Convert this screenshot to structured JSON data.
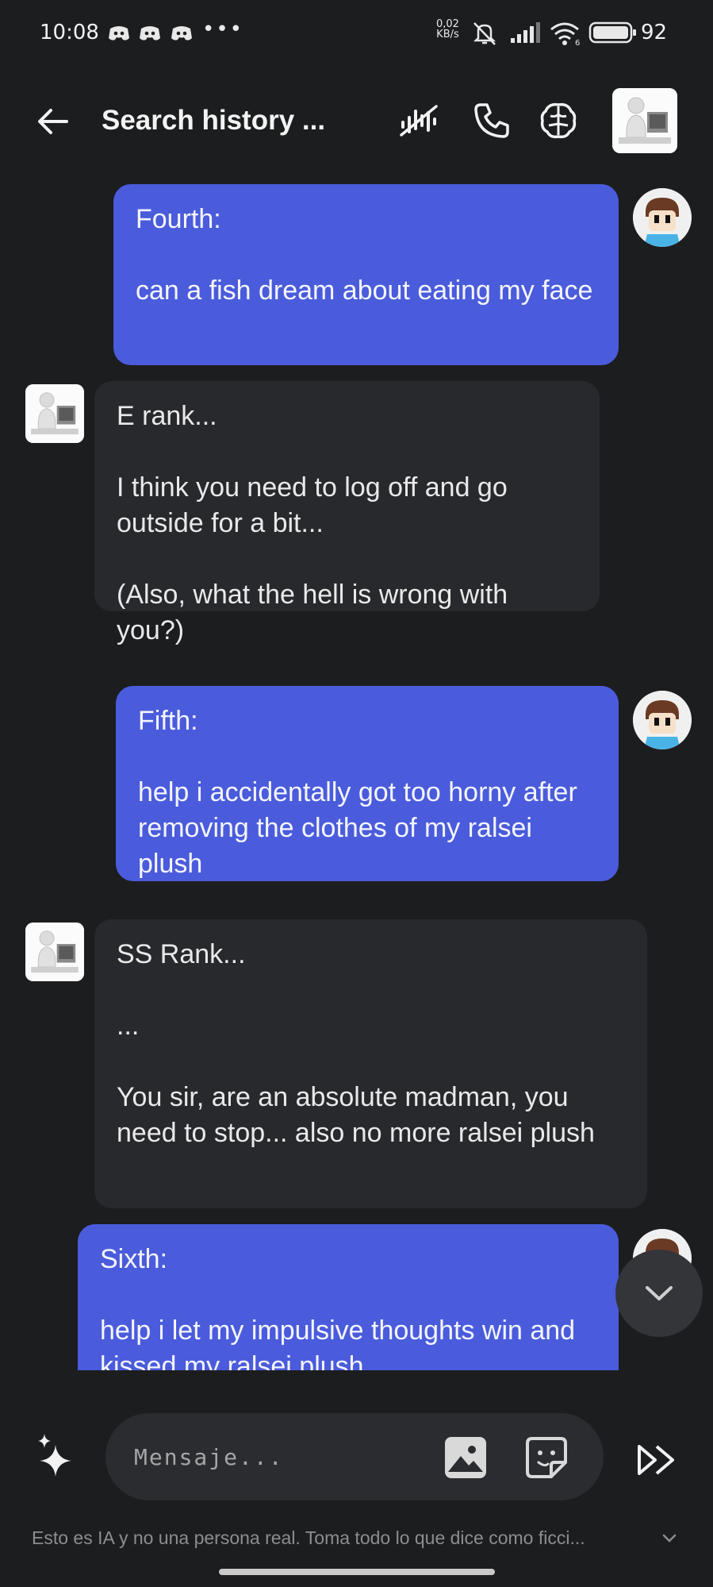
{
  "status_bar": {
    "time": "10:08",
    "more_indicator": "•••",
    "net_speed_value": "0,02",
    "net_speed_unit": "KB/s",
    "battery": "92",
    "notification_icons": [
      "discord-icon",
      "discord-icon",
      "discord-icon"
    ]
  },
  "header": {
    "title": "Search history ...",
    "buttons": [
      "voice-wave-icon",
      "phone-icon",
      "brain-icon"
    ]
  },
  "messages": [
    {
      "role": "user",
      "text": "Fourth:\n\ncan a fish dream about eating my face"
    },
    {
      "role": "bot",
      "text": "E rank...\n\nI think you need to log off and go outside for a bit...\n\n(Also, what the hell is wrong with you?)"
    },
    {
      "role": "user",
      "text": "Fifth:\n\nhelp i accidentally got too horny after removing the clothes of my ralsei plush"
    },
    {
      "role": "bot",
      "text": "SS Rank...\n\n...\n\nYou sir, are an absolute madman, you need to stop... also no more ralsei plush"
    },
    {
      "role": "user",
      "text": "Sixth:\n\nhelp i let my impulsive thoughts win and kissed my ralsei plush"
    }
  ],
  "composer": {
    "placeholder": "Mensaje..."
  },
  "disclaimer": "Esto es IA y no una persona real. Toma todo lo que dice como ficci...",
  "colors": {
    "background": "#1c1d1f",
    "user_bubble": "#4a5cdb",
    "bot_bubble": "#28292c"
  }
}
